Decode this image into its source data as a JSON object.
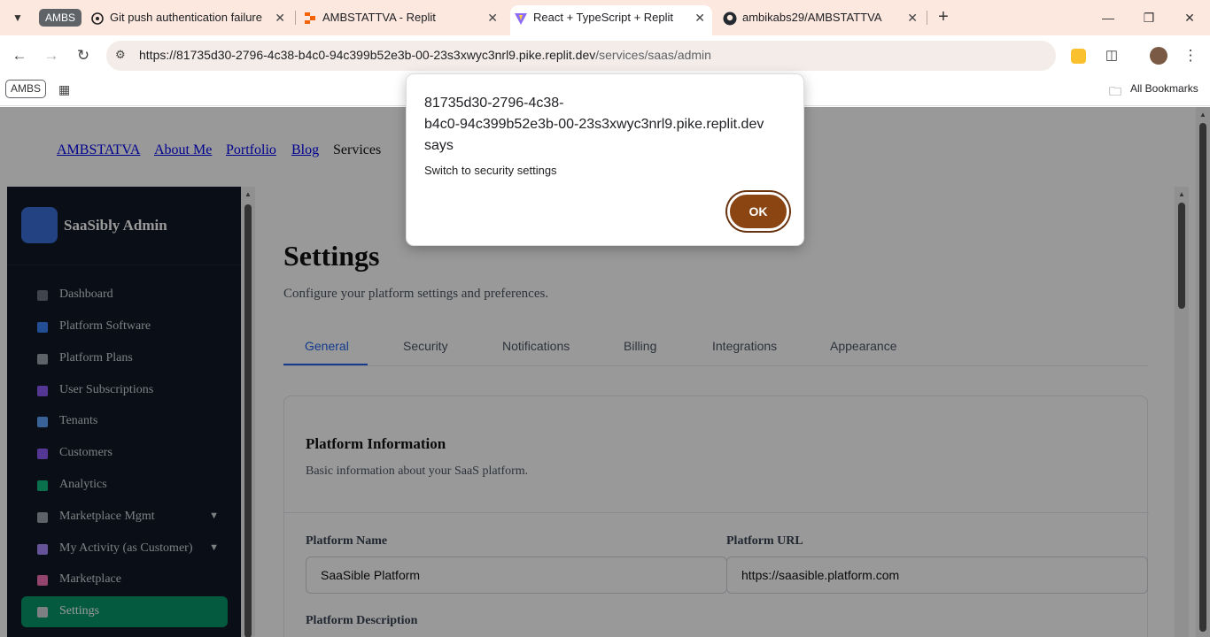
{
  "browser": {
    "group_chip": "AMBS",
    "tabs": [
      {
        "title": "Git push authentication failure"
      },
      {
        "title": "AMBSTATTVA - Replit"
      },
      {
        "title": "React + TypeScript + Replit"
      },
      {
        "title": "ambikabs29/AMBSTATTVA"
      }
    ],
    "url_host": "https://81735d30-2796-4c38-b4c0-94c399b52e3b-00-23s3xwyc3nrl9.pike.replit.dev",
    "url_path": "/services/saas/admin",
    "bookmark_chip": "AMBS",
    "all_bookmarks": "All Bookmarks"
  },
  "site_nav": {
    "brand": "AMBSTATVA",
    "about": "About Me",
    "portfolio": "Portfolio",
    "blog": "Blog",
    "services": "Services"
  },
  "sidebar": {
    "title": "SaaSibly Admin",
    "items": [
      {
        "label": "Dashboard",
        "icon": "chart-icon",
        "color": "#6b7280"
      },
      {
        "label": "Platform Software",
        "icon": "monitor-icon",
        "color": "#3b82f6"
      },
      {
        "label": "Platform Plans",
        "icon": "clipboard-icon",
        "color": "#9ca3af"
      },
      {
        "label": "User Subscriptions",
        "icon": "user-icon",
        "color": "#8b5cf6"
      },
      {
        "label": "Tenants",
        "icon": "building-icon",
        "color": "#60a5fa"
      },
      {
        "label": "Customers",
        "icon": "users-icon",
        "color": "#8b5cf6"
      },
      {
        "label": "Analytics",
        "icon": "bar-chart-icon",
        "color": "#10b981"
      },
      {
        "label": "Marketplace Mgmt",
        "icon": "store-icon",
        "color": "#9ca3af"
      },
      {
        "label": "My Activity (as Customer)",
        "icon": "list-icon",
        "color": "#a78bfa"
      },
      {
        "label": "Marketplace",
        "icon": "shop-icon",
        "color": "#f472b6"
      },
      {
        "label": "Settings",
        "icon": "gear-icon",
        "color": "#d1d5db"
      }
    ]
  },
  "page": {
    "title": "Settings",
    "subtitle": "Configure your platform settings and preferences.",
    "tabs": [
      "General",
      "Security",
      "Notifications",
      "Billing",
      "Integrations",
      "Appearance"
    ],
    "active_tab": "General"
  },
  "card": {
    "title": "Platform Information",
    "subtitle": "Basic information about your SaaS platform.",
    "platform_name_label": "Platform Name",
    "platform_name_value": "SaaSible Platform",
    "platform_url_label": "Platform URL",
    "platform_url_value": "https://saasible.platform.com",
    "description_label": "Platform Description"
  },
  "dialog": {
    "origin_line1": "81735d30-2796-4c38-",
    "origin_line2": "b4c0-94c399b52e3b-00-23s3xwyc3nrl9.pike.replit.dev",
    "origin_line3": "says",
    "message": "Switch to security settings",
    "ok_label": "OK"
  },
  "colors": {
    "accent": "#2563eb",
    "sidebar_bg": "#111827",
    "active_item": "#059669",
    "ok_button": "#8b4513"
  }
}
